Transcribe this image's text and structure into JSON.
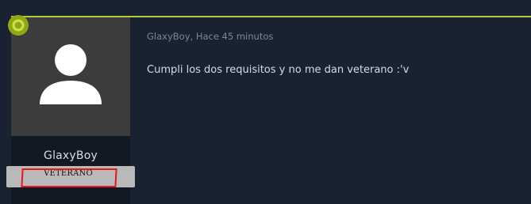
{
  "post": {
    "author": "GlaxyBoy",
    "separator": ", ",
    "timestamp": "Hace 45 minutos",
    "body": "Cumpli los dos requisitos y no me dan veterano :'v"
  },
  "user_card": {
    "username": "GlaxyBoy",
    "rank": "VETERANO",
    "status_icon": "online-dot-icon",
    "avatar_icon": "default-user-avatar-icon"
  },
  "colors": {
    "background": "#192230",
    "sidebar": "#111922",
    "avatar_bg": "#3c3c3c",
    "accent_line": "#b7c93a",
    "online_dot": "#8fa817",
    "rank_badge": "#b9b9b9",
    "highlight_outline": "#e3191c",
    "text_primary": "#d7dce2",
    "text_muted": "#7d8793"
  }
}
